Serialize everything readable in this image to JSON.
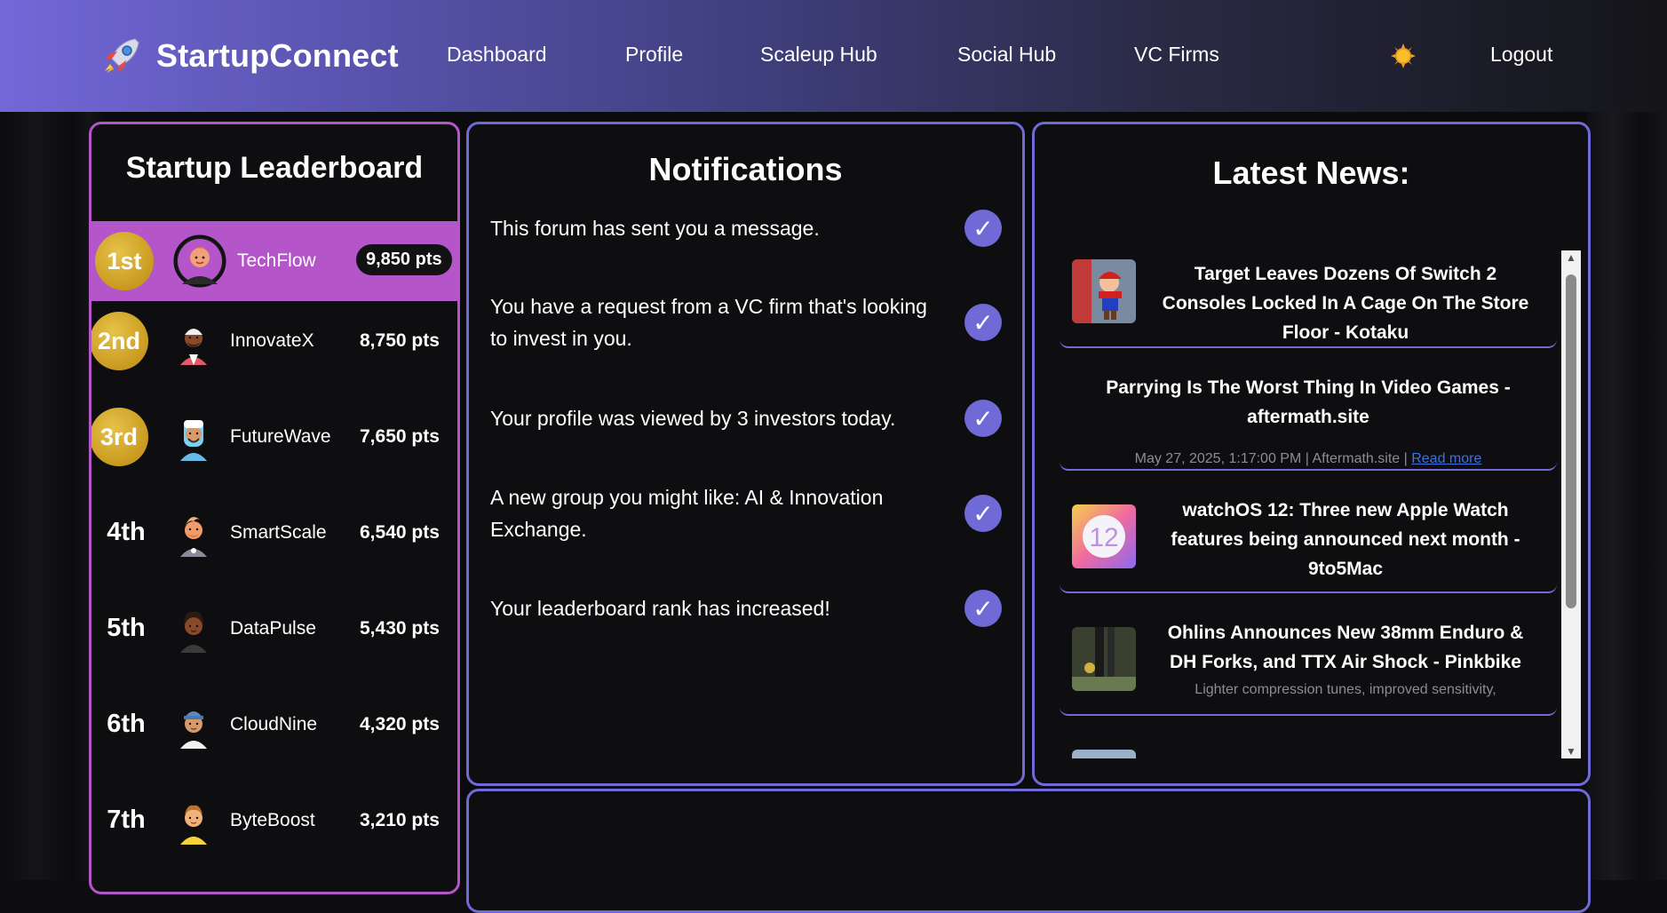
{
  "brand": {
    "name": "StartupConnect",
    "icon": "rocket-icon"
  },
  "nav": {
    "items": [
      "Dashboard",
      "Profile",
      "Scaleup Hub",
      "Social Hub",
      "VC Firms"
    ],
    "theme_icon": "sun-icon",
    "logout": "Logout"
  },
  "leaderboard": {
    "title": "Startup Leaderboard",
    "entries": [
      {
        "rank": "1st",
        "name": "TechFlow",
        "points": "9,850 pts"
      },
      {
        "rank": "2nd",
        "name": "InnovateX",
        "points": "8,750 pts"
      },
      {
        "rank": "3rd",
        "name": "FutureWave",
        "points": "7,650 pts"
      },
      {
        "rank": "4th",
        "name": "SmartScale",
        "points": "6,540 pts"
      },
      {
        "rank": "5th",
        "name": "DataPulse",
        "points": "5,430 pts"
      },
      {
        "rank": "6th",
        "name": "CloudNine",
        "points": "4,320 pts"
      },
      {
        "rank": "7th",
        "name": "ByteBoost",
        "points": "3,210 pts"
      }
    ]
  },
  "notifications": {
    "title": "Notifications",
    "check_glyph": "✓",
    "items": [
      "This forum has sent you a message.",
      "You have a request from a VC firm that's looking to invest in you.",
      "Your profile was viewed by 3 investors today.",
      "A new group you might like: AI & Innovation Exchange.",
      "Your leaderboard rank has increased!"
    ]
  },
  "news": {
    "title": "Latest News:",
    "items": [
      {
        "headline": "Target Leaves Dozens Of Switch 2 Consoles Locked In A Cage On The Store Floor - Kotaku"
      },
      {
        "headline": "Parrying Is The Worst Thing In Video Games - aftermath.site",
        "meta": "May 27, 2025, 1:17:00 PM | Aftermath.site |",
        "read_more": "Read more"
      },
      {
        "headline": "watchOS 12: Three new Apple Watch features being announced next month - 9to5Mac"
      },
      {
        "headline": "Ohlins Announces New 38mm Enduro & DH Forks, and TTX Air Shock - Pinkbike",
        "meta": "Lighter compression tunes, improved sensitivity,"
      }
    ]
  },
  "colors": {
    "accent": "#6f6ad6",
    "leader_border": "#b455c9",
    "gold": "#c99a1f"
  }
}
